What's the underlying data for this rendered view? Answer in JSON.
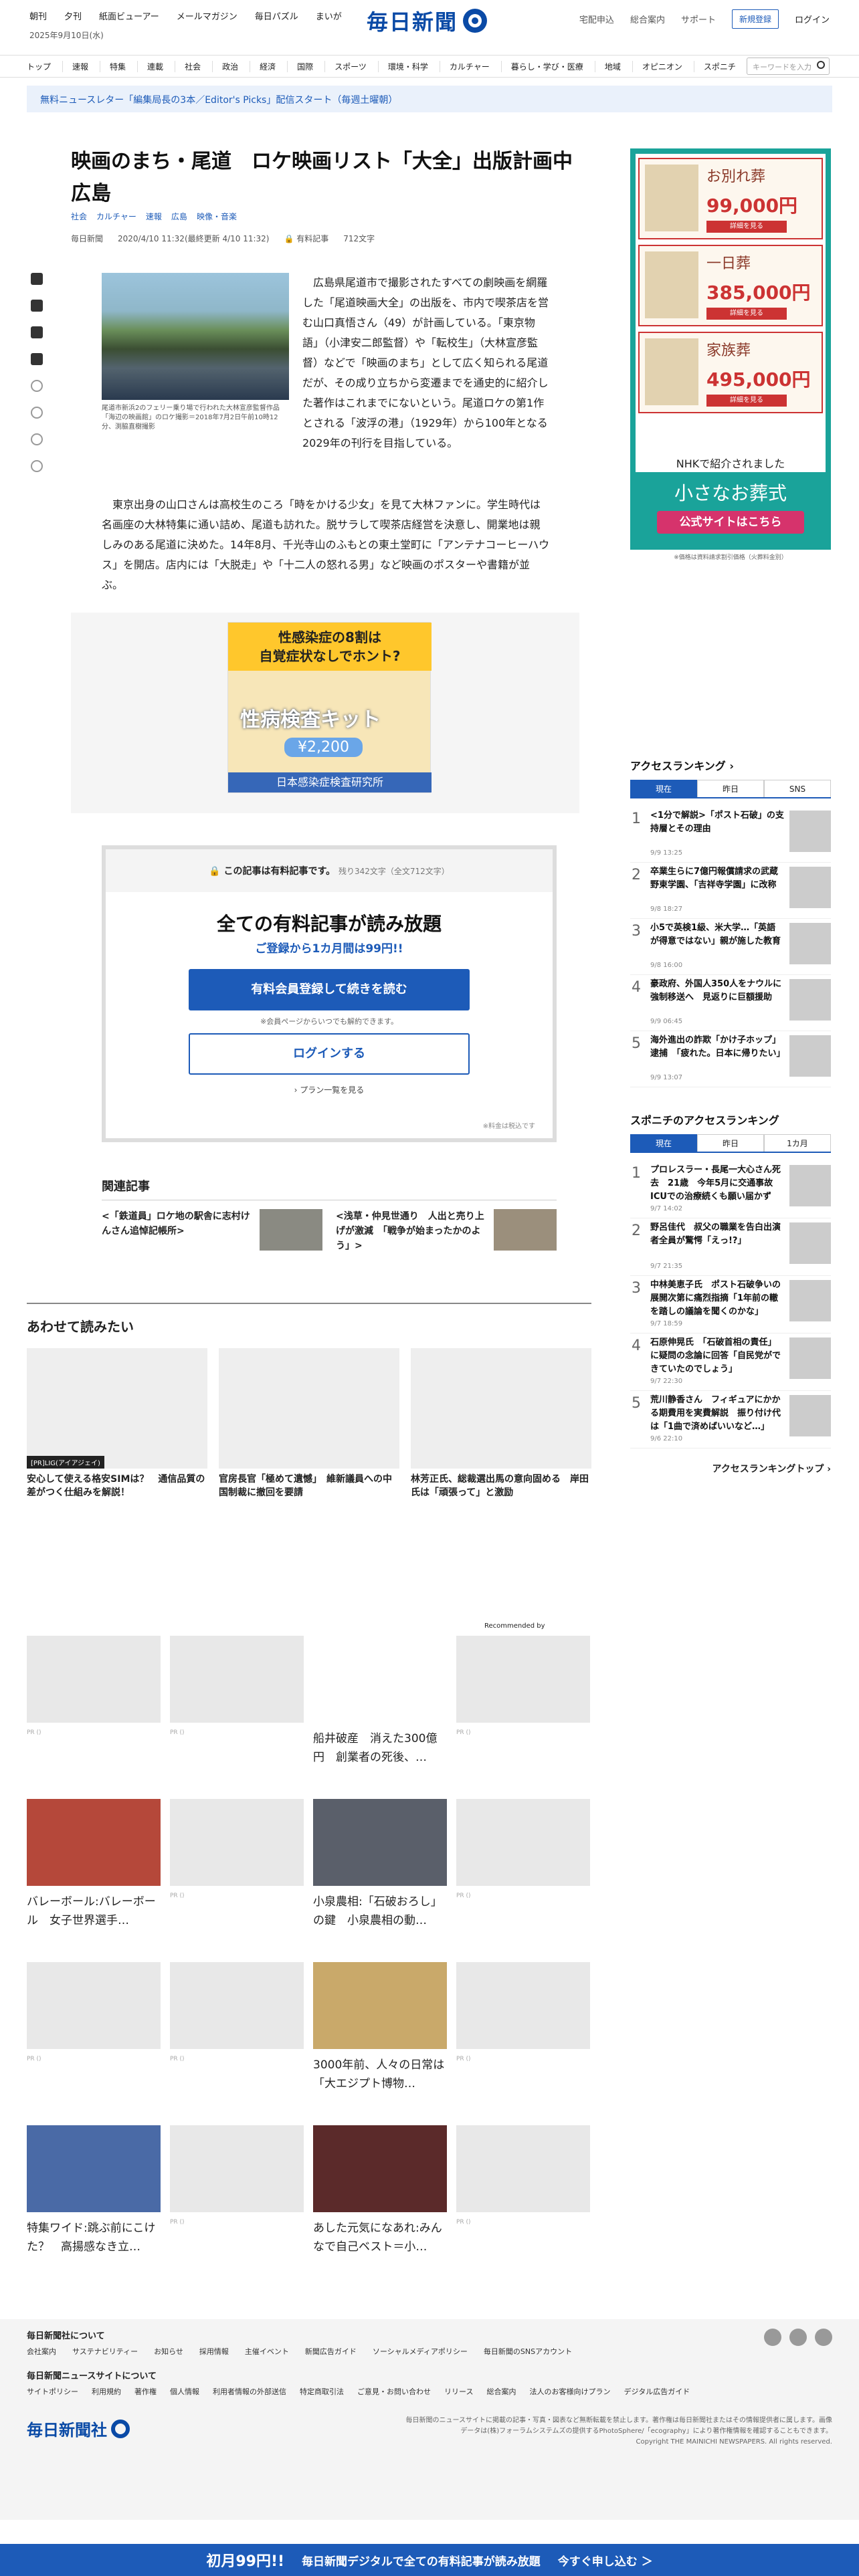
{
  "header": {
    "links": [
      "朝刊",
      "夕刊",
      "紙面ビューアー",
      "メールマガジン",
      "毎日パズル",
      "まいが"
    ],
    "date": "2025年9月10日(水)",
    "logo_text": "毎日新聞",
    "right_links": [
      "宅配申込",
      "総合案内",
      "サポート"
    ],
    "register_label": "新規登録",
    "login_label": "ログイン",
    "nav": [
      "トップ",
      "速報",
      "特集",
      "連載",
      "社会",
      "政治",
      "経済",
      "国際",
      "スポーツ",
      "環境・科学",
      "カルチャー",
      "暮らし・学び・医療",
      "地域",
      "オピニオン",
      "スポニチ"
    ],
    "search_placeholder": "キーワードを入力",
    "banner": "無料ニュースレター「編集局長の3本／Editor's Picks」配信スタート（毎週土曜朝）"
  },
  "article": {
    "title": "映画のまち・尾道　ロケ映画リスト「大全」出版計画中　広島",
    "tags": [
      "社会",
      "カルチャー",
      "速報",
      "広島",
      "映像・音楽"
    ],
    "source": "毎日新聞",
    "date": "2020/4/10 11:32(最終更新 4/10 11:32)",
    "paid_label": "有料記事",
    "char_count": "712文字",
    "caption": "尾道市新浜2のフェリー乗り場で行われた大林宣彦監督作品「海辺の映画館」のロケ撮影＝2018年7月2日午前10時12分、渕脇直樹撮影",
    "p1": "広島県尾道市で撮影されたすべての劇映画を網羅した「尾道映画大全」の出版を、市内で喫茶店を営む山口真悟さん（49）が計画している。「東京物語」（小津安二郎監督）や「転校生」（大林宣彦監督）などで「映画のまち」として広く知られる尾道だが、その成り立ちから変遷までを通史的に紹介した著作はこれまでにないという。尾道ロケの第1作とされる「波浮の港」（1929年）から100年となる2029年の刊行を目指している。",
    "p2": "東京出身の山口さんは高校生のころ「時をかける少女」を見て大林ファンに。学生時代は名画座の大林特集に通い詰め、尾道も訪れた。脱サラして喫茶店経営を決意し、開業地は親しみのある尾道に決めた。14年8月、千光寺山のふもとの東土堂町に「アンテナコーヒーハウス」を開店。店内には「大脱走」や「十二人の怒れる男」など映画のポスターや書籍が並ぶ。"
  },
  "ad_inline": {
    "line1": "性感染症の8割は",
    "line2": "自覚症状なしでホント?",
    "kit": "性病検査キット",
    "price": "¥2,200",
    "org": "日本感染症検査研究所"
  },
  "paywall": {
    "head": "この記事は有料記事です。",
    "remain": "残り342文字（全文712文字）",
    "title": "全ての有料記事が読み放題",
    "sub": "ご登録から1カ月間は99円!!",
    "btn_register": "有料会員登録して続きを読む",
    "note": "※会員ページからいつでも解約できます。",
    "btn_login": "ログインする",
    "plans": "プラン一覧を見る",
    "tax": "※料金は税込です"
  },
  "related": {
    "heading": "関連記事",
    "items": [
      "<「鉄道員」ロケ地の駅舎に志村けんさん追悼記帳所>",
      "<浅草・仲見世通り　人出と売り上げが激減　「戦争が始まったかのよう」>"
    ]
  },
  "recommend": {
    "heading": "あわせて読みたい",
    "cards": [
      {
        "label": "[PR]LIG(アイアジェイ)",
        "title": "安心して使える格安SIMは？　通信品質の差がつく仕組みを解説！"
      },
      {
        "label": "",
        "title": "官房長官「極めて遺憾」　維新議員への中国制裁に撤回を要請"
      },
      {
        "label": "",
        "title": "林芳正氏、総裁選出馬の意向固める　岸田氏は「頑張って」と激励"
      }
    ],
    "by": "Recommended by",
    "grid": [
      {
        "title": "",
        "pr": "PR ()"
      },
      {
        "title": "",
        "pr": "PR ()"
      },
      {
        "title": "船井破産　消えた300億円　創業者の死後、…",
        "pr": ""
      },
      {
        "title": "",
        "pr": "PR ()"
      },
      {
        "title": "バレーボール:バレーボール　女子世界選手…",
        "pr": ""
      },
      {
        "title": "",
        "pr": "PR ()"
      },
      {
        "title": "小泉農相:「石破おろし」の鍵　小泉農相の動…",
        "pr": ""
      },
      {
        "title": "",
        "pr": "PR ()"
      },
      {
        "title": "",
        "pr": "PR ()"
      },
      {
        "title": "",
        "pr": "PR ()"
      },
      {
        "title": "3000年前、人々の日常は　「大エジプト博物…",
        "pr": ""
      },
      {
        "title": "",
        "pr": "PR ()"
      },
      {
        "title": "特集ワイド:跳ぶ前にこけた？　高揚感なき立…",
        "pr": ""
      },
      {
        "title": "",
        "pr": "PR ()"
      },
      {
        "title": "あした元気になあれ:みんなで自己ベスト＝小…",
        "pr": ""
      },
      {
        "title": "",
        "pr": "PR ()"
      }
    ]
  },
  "sidebar": {
    "ad_rows": [
      {
        "name": "お別れ葬",
        "price": "99,000円",
        "detail": "詳細を見る"
      },
      {
        "name": "一日葬",
        "price": "385,000円",
        "detail": "詳細を見る"
      },
      {
        "name": "家族葬",
        "price": "495,000円",
        "detail": "詳細を見る"
      }
    ],
    "ad_nhk": "NHKで紹介されました",
    "ad_brand": "小さなお葬式",
    "ad_btn": "公式サイトはこちら",
    "ad_cap": "※価格は資料請求割引価格（火葬料金別）",
    "rank1_title": "アクセスランキング",
    "rank1_tabs": [
      "現在",
      "昨日",
      "SNS"
    ],
    "rank1": [
      {
        "n": "1",
        "t": "<1分で解説>「ポスト石破」の支持層とその理由",
        "d": "9/9 13:25"
      },
      {
        "n": "2",
        "t": "卒業生らに7億円報償請求の武蔵野東学園、「吉祥寺学園」に改称",
        "d": "9/8 18:27"
      },
      {
        "n": "3",
        "t": "小5で英検1級、米大学…「英語が得意ではない」親が施した教育",
        "d": "9/8 16:00"
      },
      {
        "n": "4",
        "t": "豪政府、外国人350人をナウルに強制移送へ　見返りに巨額援助",
        "d": "9/9 06:45"
      },
      {
        "n": "5",
        "t": "海外進出の詐欺「かけ子ホップ」逮捕　「疲れた。日本に帰りたい」",
        "d": "9/9 13:07"
      }
    ],
    "rank2_title": "スポニチのアクセスランキング",
    "rank2_tabs": [
      "現在",
      "昨日",
      "1カ月"
    ],
    "rank2": [
      {
        "n": "1",
        "t": "プロレスラー・長尾一大心さん死去　21歳　今年5月に交通事故ICUでの治療続くも願い届かず",
        "d": "9/7 14:02"
      },
      {
        "n": "2",
        "t": "野呂佳代　叔父の職業を告白出演者全員が驚愕「えっ!?」",
        "d": "9/7 21:35"
      },
      {
        "n": "3",
        "t": "中林美恵子氏　ポスト石破争いの展開次第に痛烈指摘「1年前の轍を踏しの議論を聞くのかな」",
        "d": "9/7 18:59"
      },
      {
        "n": "4",
        "t": "石原伸晃氏　「石破首相の責任」に疑問の念論に回答「自民党ができていたのでしょう」",
        "d": "9/7 22:30"
      },
      {
        "n": "5",
        "t": "荒川静香さん　フィギュアにかかる期費用を実費解説　振り付け代は「1曲で済めばいいなど…」",
        "d": "9/6 22:10"
      }
    ],
    "rank_more": "アクセスランキングトップ"
  },
  "footer": {
    "h1": "毎日新聞社について",
    "links1": [
      "会社案内",
      "サステナビリティー",
      "お知らせ",
      "採用情報",
      "主催イベント",
      "新聞広告ガイド",
      "ソーシャルメディアポリシー",
      "毎日新聞のSNSアカウント"
    ],
    "h2": "毎日新聞ニュースサイトについて",
    "links2": [
      "サイトポリシー",
      "利用規約",
      "著作権",
      "個人情報",
      "利用者情報の外部送信",
      "特定商取引法",
      "ご意見・お問い合わせ",
      "リリース",
      "総合案内",
      "法人のお客様向けプラン",
      "デジタル広告ガイド"
    ],
    "logo": "毎日新聞社",
    "copy": "毎日新聞のニュースサイトに掲載の記事・写真・図表など無断転載を禁止します。著作権は毎日新聞社またはその情報提供者に属します。画像データは(株)フォーラムシステムズの提供するPhotoSphere/「ecography」により著作権情報を確認することもできます。",
    "copyright": "Copyright THE MAINICHI NEWSPAPERS. All rights reserved."
  },
  "bottom_bar": {
    "a": "初月99円!!",
    "b": "毎日新聞デジタルで全ての有料記事が読み放題",
    "c": "今すぐ申し込む ＞"
  }
}
